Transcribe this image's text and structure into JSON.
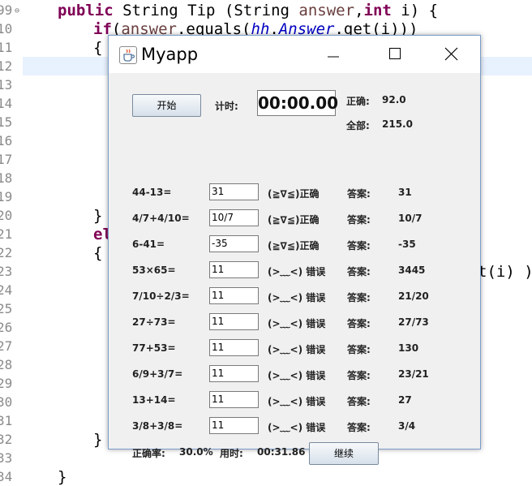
{
  "editor": {
    "line_numbers": [
      "99",
      "10",
      "11",
      "12",
      "13",
      "14",
      "15",
      "16",
      "17",
      "18",
      "19",
      "20",
      "21",
      "22",
      "23",
      "24",
      "25",
      "26",
      "27",
      "28",
      "29",
      "30",
      "31",
      "32",
      "33",
      "34"
    ],
    "line1": {
      "kw1": "public",
      "t1": " String Tip (String ",
      "var1": "answer",
      "t2": ",",
      "kw2": "int",
      "t3": " i) {"
    },
    "line2": {
      "kw": "if",
      "t1": "(",
      "var": "answer",
      "t2": ".equals(",
      "fld1": "hh",
      "t3": ".",
      "fld2": "Answer",
      "t4": ".get(i)))"
    },
    "brace_open": "{",
    "brace_close": "}",
    "else_frag": "el",
    "trailing_frag": "t(i) )"
  },
  "window": {
    "title": "Myapp",
    "icon": "java-cup-icon"
  },
  "header": {
    "start_button": "开始",
    "timer_label": "计时:",
    "timer_value": "00:00.00",
    "correct_label": "正确:",
    "correct_value": "92.0",
    "total_label": "全部:",
    "total_value": "215.0"
  },
  "answer_label": "答案:",
  "questions": [
    {
      "question": "44-13=",
      "input": "31",
      "result": "(≧∇≦)正确",
      "answer": "31"
    },
    {
      "question": "4/7+4/10=",
      "input": "10/7",
      "result": "(≧∇≦)正确",
      "answer": "10/7"
    },
    {
      "question": "6-41=",
      "input": "-35",
      "result": "(≧∇≦)正确",
      "answer": "-35"
    },
    {
      "question": "53×65=",
      "input": "11",
      "result": "(>﹏<) 错误",
      "answer": "3445"
    },
    {
      "question": "7/10÷2/3=",
      "input": "11",
      "result": "(>﹏<) 错误",
      "answer": "21/20"
    },
    {
      "question": "27÷73=",
      "input": "11",
      "result": "(>﹏<) 错误",
      "answer": "27/73"
    },
    {
      "question": "77+53=",
      "input": "11",
      "result": "(>﹏<) 错误",
      "answer": "130"
    },
    {
      "question": "6/9+3/7=",
      "input": "11",
      "result": "(>﹏<) 错误",
      "answer": "23/21"
    },
    {
      "question": "13+14=",
      "input": "11",
      "result": "(>﹏<) 错误",
      "answer": "27"
    },
    {
      "question": "3/8+3/8=",
      "input": "11",
      "result": "(>﹏<) 错误",
      "answer": "3/4"
    }
  ],
  "footer": {
    "accuracy_label": "正确率:",
    "accuracy_value": "30.0%",
    "time_label": "用时:",
    "time_value": "00:31.86",
    "continue_button": "继续"
  }
}
